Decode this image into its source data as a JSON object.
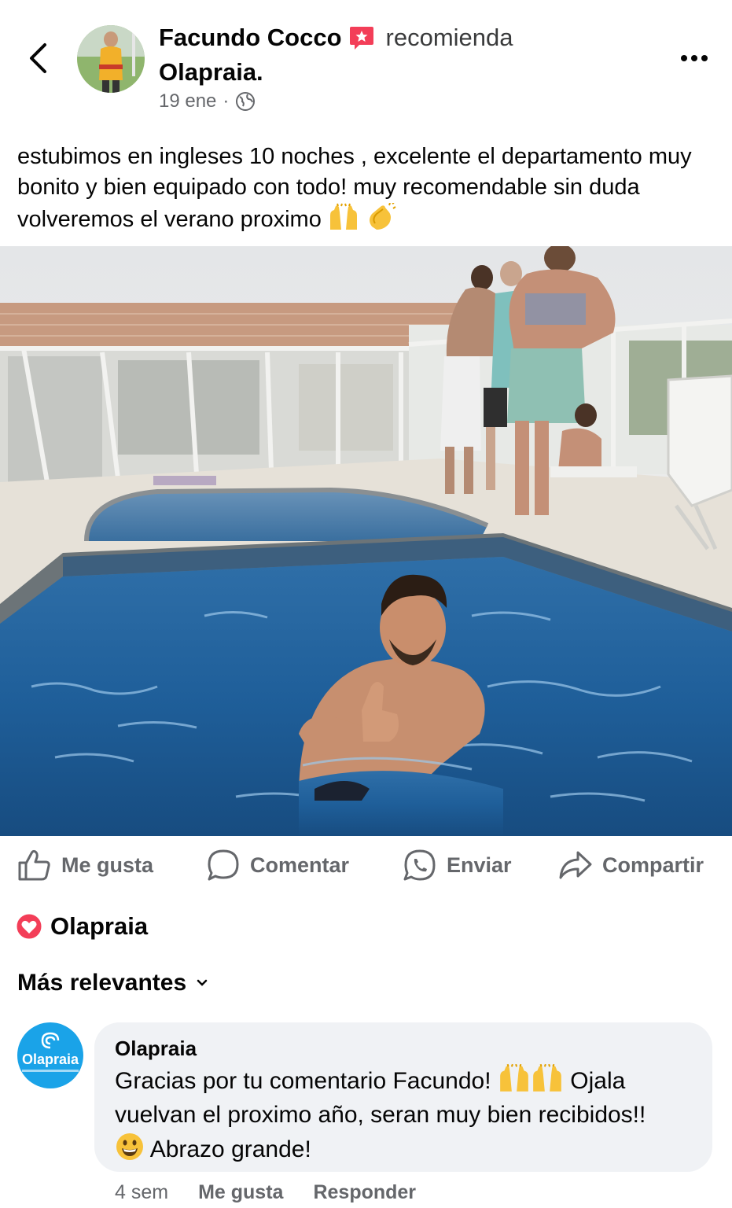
{
  "post": {
    "author": "Facundo Cocco",
    "action_text": "recomienda",
    "page_name": "Olapraia.",
    "date": "19 ene",
    "separator": "·",
    "audience_icon": "globe-icon",
    "text": "estubimos en ingleses 10 noches , excelente el departamento muy bonito y bien equipado con todo! muy recomendable sin duda volveremos el verano proximo",
    "text_emojis": [
      "raising-hands-emoji",
      "clapping-hands-emoji"
    ]
  },
  "actions": {
    "like": "Me gusta",
    "comment": "Comentar",
    "send": "Enviar",
    "share": "Compartir"
  },
  "reactions": {
    "label": "Olapraia",
    "icon": "heart-icon",
    "color": "#f33e58"
  },
  "comments_sort": {
    "label": "Más relevantes"
  },
  "comment": {
    "author": "Olapraia",
    "avatar_text": "Olapraia",
    "text_part1": "Gracias por tu comentario Facundo!",
    "text_part2": "Ojala vuelvan el proximo año, seran muy bien recibidos!!",
    "text_part3": "Abrazo grande!",
    "time": "4 sem",
    "like": "Me gusta",
    "reply": "Responder"
  },
  "colors": {
    "text": "#050505",
    "secondary": "#65676b",
    "bubble": "#f0f2f5",
    "brand": "#1aa3e8",
    "pool": "#1f5f9a"
  }
}
